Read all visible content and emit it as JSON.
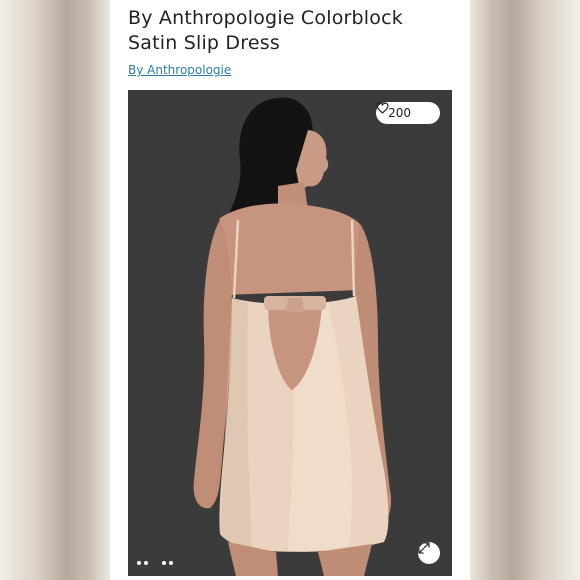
{
  "listing": {
    "title": "By Anthropologie Colorblock Satin Slip Dress",
    "brand_link": "By Anthropologie"
  },
  "photo": {
    "like_count": "200",
    "like_icon": "heart-outline-icon",
    "expand_icon": "expand-arrows-icon",
    "background_color": "#3a3a3b",
    "dress_color": "#ead3bf"
  }
}
